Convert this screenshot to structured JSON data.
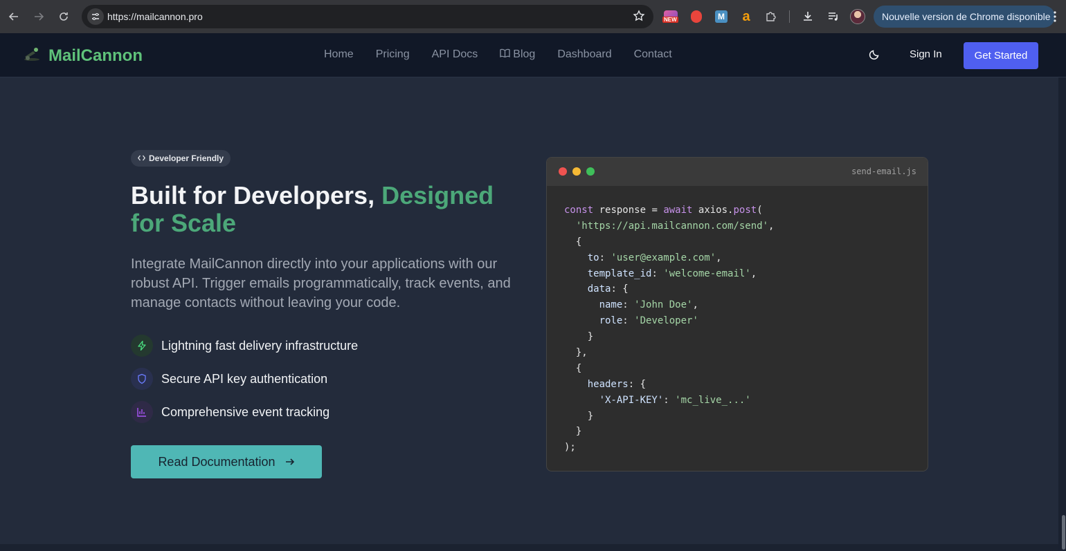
{
  "browser": {
    "url": "https://mailcannon.pro",
    "extension_new_badge": "NEW",
    "update_label": "Nouvelle version de Chrome disponible"
  },
  "site": {
    "brand": "MailCannon",
    "nav": [
      "Home",
      "Pricing",
      "API Docs",
      "Blog",
      "Dashboard",
      "Contact"
    ],
    "sign_in": "Sign In",
    "get_started": "Get Started"
  },
  "hero": {
    "badge": "Developer Friendly",
    "headline_plain": "Built for Developers, ",
    "headline_accent": "Designed for Scale",
    "lead": "Integrate MailCannon directly into your applications with our robust API. Trigger emails programmatically, track events, and manage contacts without leaving your code.",
    "features": [
      {
        "icon": "lightning-icon",
        "label": "Lightning fast delivery infrastructure",
        "color": "#4ade80"
      },
      {
        "icon": "shield-icon",
        "label": "Secure API key authentication",
        "color": "#6b7cff"
      },
      {
        "icon": "bar-chart-icon",
        "label": "Comprehensive event tracking",
        "color": "#a855f7"
      }
    ],
    "cta": "Read Documentation"
  },
  "code": {
    "filename": "send-email.js",
    "lines": [
      [
        {
          "t": "const",
          "c": "kw"
        },
        {
          "t": " response = ",
          "c": "fn"
        },
        {
          "t": "await",
          "c": "kw"
        },
        {
          "t": " axios.",
          "c": "fn"
        },
        {
          "t": "post",
          "c": "kw"
        },
        {
          "t": "(",
          "c": "fn"
        }
      ],
      [
        {
          "t": "  ",
          "c": "fn"
        },
        {
          "t": "'https://api.mailcannon.com/send'",
          "c": "str"
        },
        {
          "t": ",",
          "c": "fn"
        }
      ],
      [
        {
          "t": "  {",
          "c": "fn"
        }
      ],
      [
        {
          "t": "    ",
          "c": "fn"
        },
        {
          "t": "to",
          "c": "key"
        },
        {
          "t": ": ",
          "c": "fn"
        },
        {
          "t": "'user@example.com'",
          "c": "str"
        },
        {
          "t": ",",
          "c": "fn"
        }
      ],
      [
        {
          "t": "    ",
          "c": "fn"
        },
        {
          "t": "template_id",
          "c": "key"
        },
        {
          "t": ": ",
          "c": "fn"
        },
        {
          "t": "'welcome-email'",
          "c": "str"
        },
        {
          "t": ",",
          "c": "fn"
        }
      ],
      [
        {
          "t": "    ",
          "c": "fn"
        },
        {
          "t": "data",
          "c": "key"
        },
        {
          "t": ": {",
          "c": "fn"
        }
      ],
      [
        {
          "t": "      ",
          "c": "fn"
        },
        {
          "t": "name",
          "c": "key"
        },
        {
          "t": ": ",
          "c": "fn"
        },
        {
          "t": "'John Doe'",
          "c": "str"
        },
        {
          "t": ",",
          "c": "fn"
        }
      ],
      [
        {
          "t": "      ",
          "c": "fn"
        },
        {
          "t": "role",
          "c": "key"
        },
        {
          "t": ": ",
          "c": "fn"
        },
        {
          "t": "'Developer'",
          "c": "str"
        }
      ],
      [
        {
          "t": "    }",
          "c": "fn"
        }
      ],
      [
        {
          "t": "  },",
          "c": "fn"
        }
      ],
      [
        {
          "t": "  {",
          "c": "fn"
        }
      ],
      [
        {
          "t": "    ",
          "c": "fn"
        },
        {
          "t": "headers",
          "c": "key"
        },
        {
          "t": ": {",
          "c": "fn"
        }
      ],
      [
        {
          "t": "      ",
          "c": "fn"
        },
        {
          "t": "'X-API-KEY'",
          "c": "key"
        },
        {
          "t": ": ",
          "c": "fn"
        },
        {
          "t": "'mc_live_...'",
          "c": "str"
        }
      ],
      [
        {
          "t": "    }",
          "c": "fn"
        }
      ],
      [
        {
          "t": "  }",
          "c": "fn"
        }
      ],
      [
        {
          "t": ");",
          "c": "fn"
        }
      ]
    ]
  },
  "colors": {
    "accent_green": "#4ca879",
    "brand_green": "#5fc27a",
    "button_blue": "#4f5ff0",
    "cta_teal": "#4fb7b5"
  }
}
